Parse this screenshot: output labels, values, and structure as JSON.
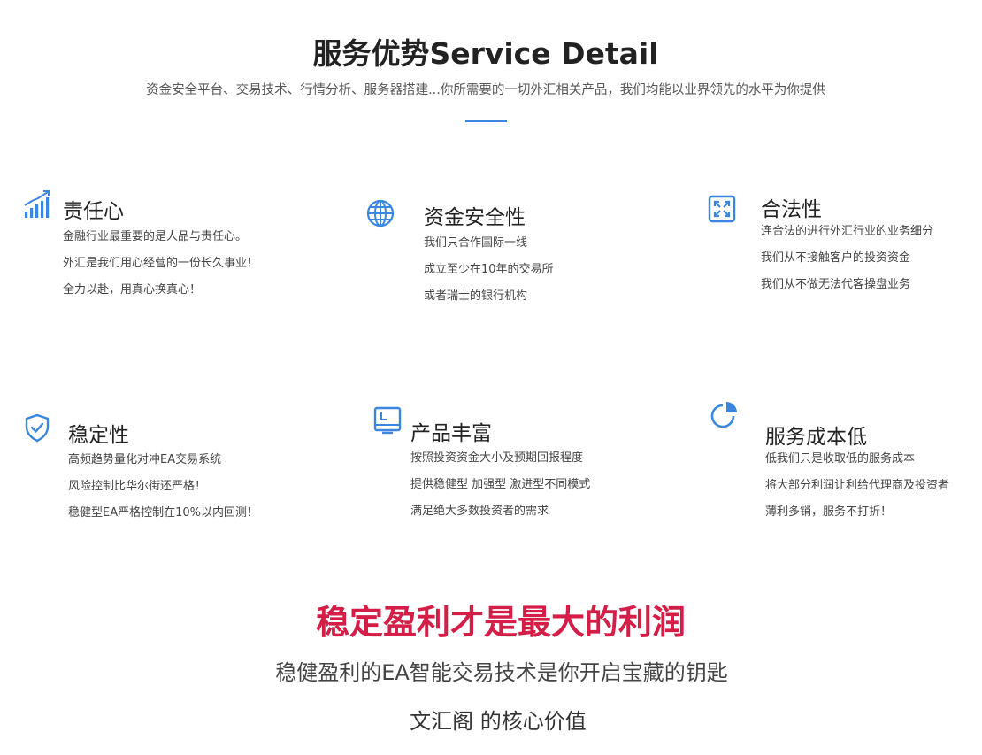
{
  "header": {
    "title": "服务优势Service Detail",
    "subtitle": "资金安全平台、交易技术、行情分析、服务器搭建...你所需要的一切外汇相关产品，我们均能以业界领先的水平为你提供"
  },
  "colors": {
    "accent": "#3a86e0",
    "slogan": "#d41e48"
  },
  "features": [
    {
      "icon": "rising-bar-chart-icon",
      "title": "责任心",
      "lines": [
        "金融行业最重要的是人品与责任心。",
        "外汇是我们用心经营的一份长久事业！",
        "全力以赴，用真心换真心！"
      ]
    },
    {
      "icon": "globe-icon",
      "title": "资金安全性",
      "lines": [
        "我们只合作国际一线",
        "成立至少在10年的交易所",
        "或者瑞士的银行机构"
      ]
    },
    {
      "icon": "expand-arrows-icon",
      "title": "合法性",
      "lines": [
        "连合法的进行外汇行业的业务细分",
        "我们从不接触客户的投资资金",
        "我们从不做无法代客操盘业务"
      ]
    },
    {
      "icon": "shield-check-icon",
      "title": "稳定性",
      "lines": [
        "高频趋势量化对冲EA交易系统",
        "风险控制比华尔街还严格！",
        "稳健型EA严格控制在10%以内回测！"
      ]
    },
    {
      "icon": "monitor-icon",
      "title": "产品丰富",
      "lines": [
        "按照投资资金大小及预期回报程度",
        "提供稳健型 加强型 激进型不同模式",
        "满足绝大多数投资者的需求"
      ]
    },
    {
      "icon": "pie-chart-icon",
      "title": "服务成本低",
      "lines": [
        "低我们只是收取低的服务成本",
        "将大部分利润让利给代理商及投资者",
        "薄利多销，服务不打折！"
      ]
    }
  ],
  "footer": {
    "slogan": "稳定盈利才是最大的利润",
    "tagline": "稳健盈利的EA智能交易技术是你开启宝藏的钥匙",
    "core_value": "文汇阁 的核心价值"
  }
}
